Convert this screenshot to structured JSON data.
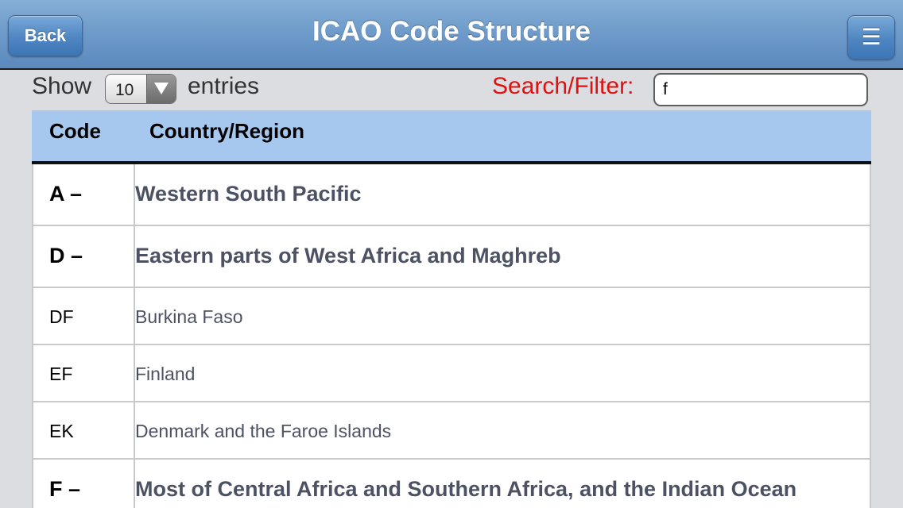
{
  "header": {
    "title": "ICAO Code Structure",
    "back_label": "Back",
    "menu_icon": "hamburger-icon",
    "menu_glyph": "☰"
  },
  "controls": {
    "show_label": "Show",
    "page_size": "10",
    "entries_label": "entries",
    "search_label": "Search/Filter:",
    "search_value": "f"
  },
  "table": {
    "columns": [
      "Code",
      "Country/Region"
    ],
    "rows": [
      {
        "code": "A –",
        "country": "Western South Pacific",
        "kind": "region"
      },
      {
        "code": "D –",
        "country": "Eastern parts of West Africa and Maghreb",
        "kind": "region"
      },
      {
        "code": "DF",
        "country": "Burkina Faso",
        "kind": "country"
      },
      {
        "code": "EF",
        "country": "Finland",
        "kind": "country"
      },
      {
        "code": "EK",
        "country": "Denmark and the Faroe Islands",
        "kind": "country"
      },
      {
        "code": "F –",
        "country": "Most of Central Africa and Southern Africa, and the Indian Ocean",
        "kind": "region"
      }
    ]
  },
  "colors": {
    "header_bar": "#6d9aca",
    "table_header": "#a6c7ee",
    "search_label": "#e01010",
    "country_text": "#4c5263"
  }
}
